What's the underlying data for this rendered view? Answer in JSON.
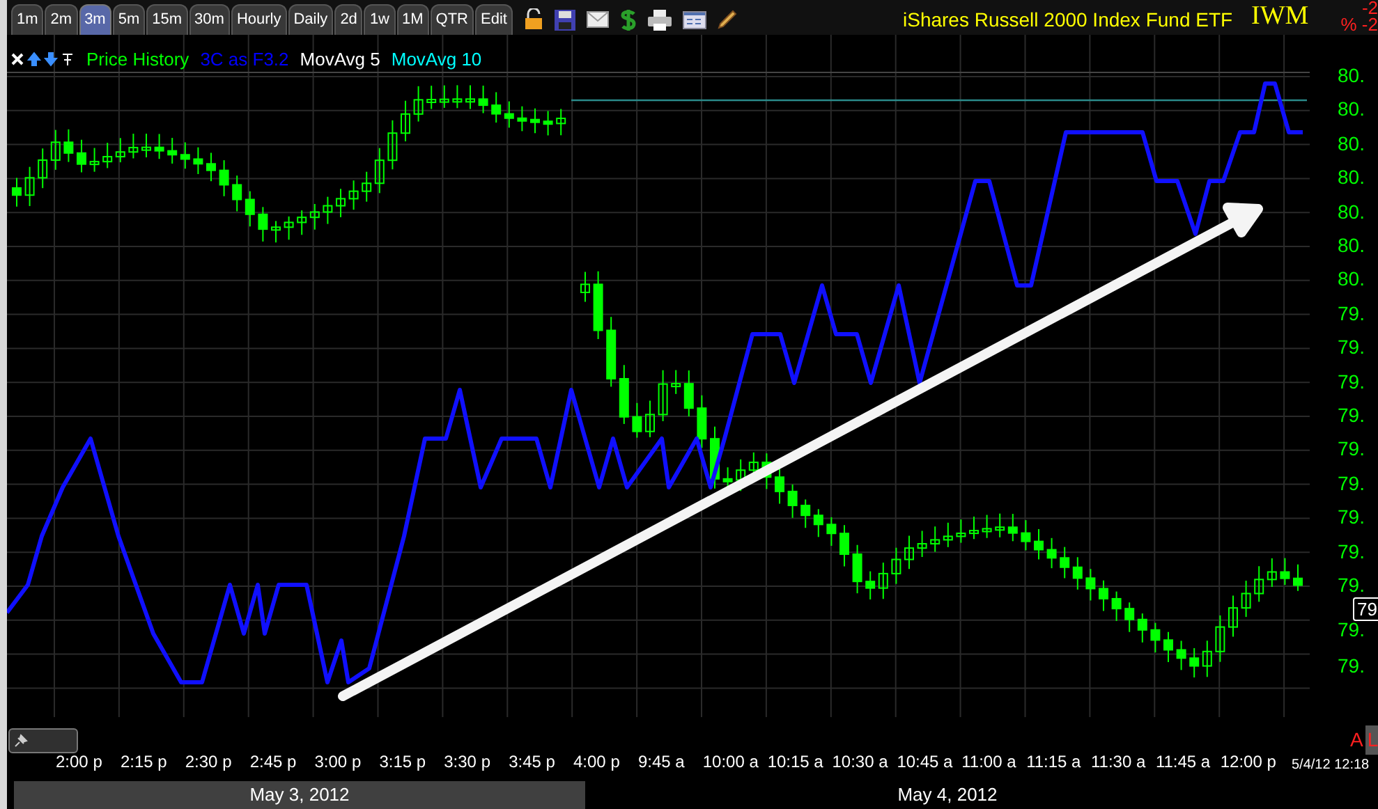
{
  "tabs": [
    {
      "label": "1m",
      "selected": false
    },
    {
      "label": "2m",
      "selected": false
    },
    {
      "label": "3m",
      "selected": true
    },
    {
      "label": "5m",
      "selected": false
    },
    {
      "label": "15m",
      "selected": false
    },
    {
      "label": "30m",
      "selected": false
    },
    {
      "label": "Hourly",
      "selected": false
    },
    {
      "label": "Daily",
      "selected": false
    },
    {
      "label": "2d",
      "selected": false
    },
    {
      "label": "1w",
      "selected": false
    },
    {
      "label": "1M",
      "selected": false
    },
    {
      "label": "QTR",
      "selected": false
    },
    {
      "label": "Edit",
      "selected": false
    }
  ],
  "title": "iShares Russell 2000 Index Fund ETF",
  "symbol": "IWM",
  "change": [
    "-2",
    "% -2"
  ],
  "legend": [
    {
      "label": "Price History",
      "color": "#00ff00"
    },
    {
      "label": "3C as F3.2",
      "color": "#0000ff"
    },
    {
      "label": "MovAvg 5",
      "color": "#ffffff"
    },
    {
      "label": "MovAvg 10",
      "color": "#00ffff"
    }
  ],
  "y_axis": [
    "80.",
    "80.",
    "80.",
    "80.",
    "80.",
    "80.",
    "80.",
    "79.",
    "79.",
    "79.",
    "79.",
    "79.",
    "79.",
    "79.",
    "79.",
    "79.",
    "79.",
    "79."
  ],
  "last_price": "79.",
  "time_labels": [
    "2:00 p",
    "2:15 p",
    "2:30 p",
    "2:45 p",
    "3:00 p",
    "3:15 p",
    "3:30 p",
    "3:45 p",
    "4:00 p",
    "9:45 a",
    "10:00 a",
    "10:15 a",
    "10:30 a",
    "10:45 a",
    "11:00 a",
    "11:15 a",
    "11:30 a",
    "11:45 a",
    "12:00 p"
  ],
  "dates": [
    {
      "label": "May 3, 2012",
      "highlighted": true
    },
    {
      "label": "May 4, 2012",
      "highlighted": false
    }
  ],
  "timestamp": "5/4/12 12:18",
  "flags": [
    "A",
    "L"
  ]
}
